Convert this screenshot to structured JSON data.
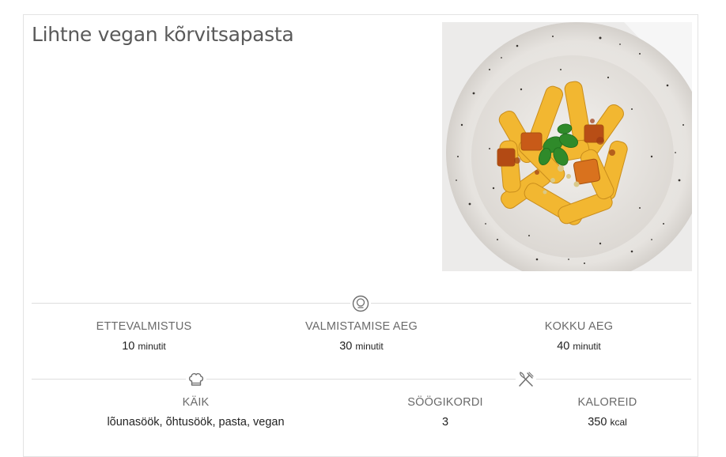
{
  "recipe": {
    "title": "Lihtne vegan kõrvitsapasta",
    "image_icon": "pumpkin-pasta-photo",
    "times": [
      {
        "label": "ETTEVALMISTUS",
        "value": "10",
        "unit": "minutit"
      },
      {
        "label": "VALMISTAMISE AEG",
        "value": "30",
        "unit": "minutit"
      },
      {
        "label": "KOKKU AEG",
        "value": "40",
        "unit": "minutit"
      }
    ],
    "course": {
      "label": "KÄIK",
      "value": "lõunasöök, õhtusöök, pasta, vegan"
    },
    "servings": {
      "label": "SÖÖGIKORDI",
      "value": "3"
    },
    "calories": {
      "label": "KALOREID",
      "value": "350",
      "unit": "kcal"
    },
    "icons": {
      "timer": "timer-icon",
      "course": "chef-hat-icon",
      "servings": "fork-knife-icon"
    }
  }
}
